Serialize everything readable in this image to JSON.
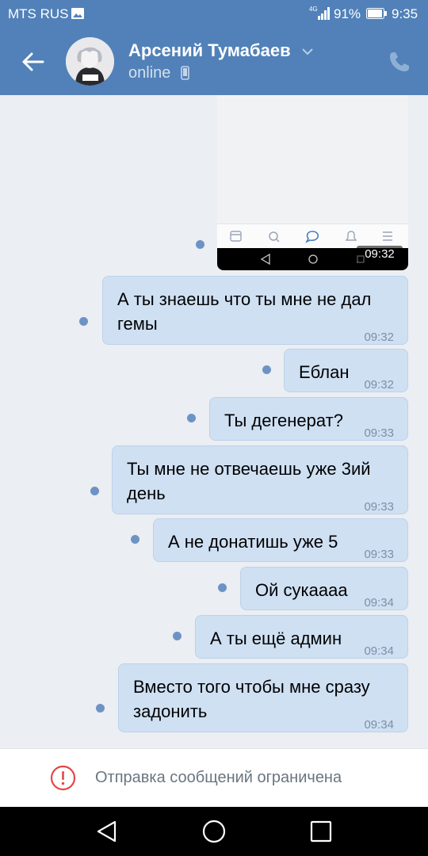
{
  "status_bar": {
    "carrier": "MTS RUS",
    "network": "4G",
    "battery": "91%",
    "time": "9:35"
  },
  "header": {
    "contact_name": "Арсений Тумабаев",
    "status": "online",
    "icons": [
      "back-arrow-icon",
      "avatar",
      "chevron-down-icon",
      "mobile-icon",
      "phone-icon"
    ]
  },
  "attachment": {
    "time": "09:32"
  },
  "messages": [
    {
      "text": "А ты знаешь что ты мне не дал\nгемы",
      "time": "09:32"
    },
    {
      "text": "Еблан",
      "time": "09:32"
    },
    {
      "text": "Ты дегенерат?",
      "time": "09:33"
    },
    {
      "text": "Ты мне не отвечаешь уже 3ий\nдень",
      "time": "09:33"
    },
    {
      "text": "А не донатишь уже 5",
      "time": "09:33"
    },
    {
      "text": "Ой сукаааа",
      "time": "09:34"
    },
    {
      "text": "А ты ещё админ",
      "time": "09:34"
    },
    {
      "text": "Вместо того чтобы мне сразу\nзадонить",
      "time": "09:34"
    }
  ],
  "footer": {
    "restricted_text": "Отправка сообщений ограничена",
    "icons": [
      "warning-icon"
    ]
  },
  "colors": {
    "header": "#5181b8",
    "bubble": "#cfe0f3",
    "chat_background": "#ebeef2",
    "warning": "#e64646"
  }
}
